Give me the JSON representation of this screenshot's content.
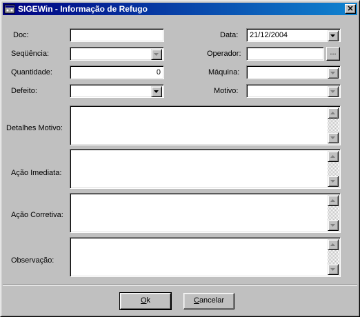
{
  "window": {
    "title": "SIGEWin - Informação de Refugo",
    "close_glyph": "✕"
  },
  "form": {
    "doc": {
      "label": "Doc:",
      "value": ""
    },
    "sequencia": {
      "label": "Seqüência:",
      "value": ""
    },
    "quantidade": {
      "label": "Quantidade:",
      "value": "0"
    },
    "defeito": {
      "label": "Defeito:",
      "value": ""
    },
    "data": {
      "label": "Data:",
      "value": "21/12/2004"
    },
    "operador": {
      "label": "Operador:",
      "value": "",
      "browse_label": "..."
    },
    "maquina": {
      "label": "Máquina:",
      "value": ""
    },
    "motivo": {
      "label": "Motivo:",
      "value": ""
    },
    "detalhes_motivo": {
      "label": "Detalhes Motivo:",
      "value": ""
    },
    "acao_imediata": {
      "label": "Ação Imediata:",
      "value": ""
    },
    "acao_corretiva": {
      "label": "Ação Corretiva:",
      "value": ""
    },
    "observacao": {
      "label": "Observação:",
      "value": ""
    }
  },
  "buttons": {
    "ok_mnemonic": "O",
    "ok_rest": "k",
    "cancel_mnemonic": "C",
    "cancel_rest": "ancelar"
  },
  "icons": {
    "app": "app-icon",
    "close": "close-icon",
    "dropdown": "chevron-down-icon",
    "scroll_up": "scroll-up-arrow-icon",
    "scroll_down": "scroll-down-arrow-icon"
  },
  "colors": {
    "face": "#c0c0c0",
    "title_start": "#000080",
    "title_end": "#1084d0"
  }
}
